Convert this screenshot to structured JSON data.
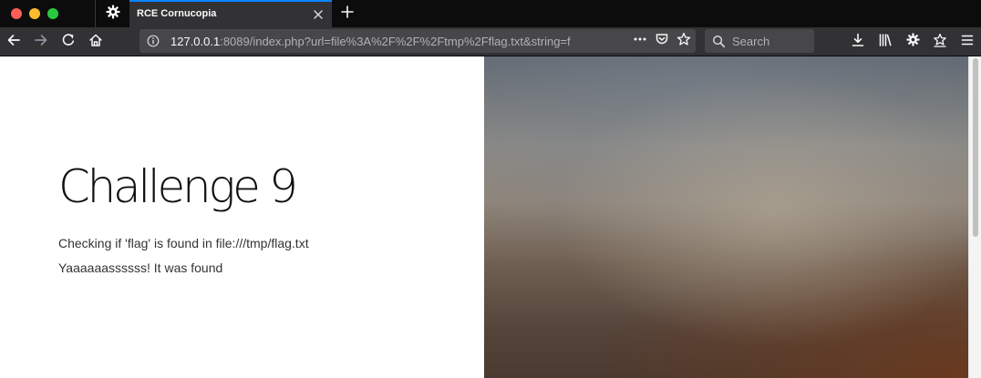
{
  "browser": {
    "tab": {
      "title": "RCE Cornucopia"
    },
    "url": {
      "host": "127.0.0.1",
      "rest": ":8089/index.php?url=file%3A%2F%2F%2Ftmp%2Fflag.txt&string=f"
    },
    "search": {
      "placeholder": "Search"
    }
  },
  "page": {
    "heading": "Challenge 9",
    "lines": [
      "Checking if 'flag' is found in file:///tmp/flag.txt",
      "Yaaaaaassssss! It was found"
    ]
  },
  "icons": {
    "tab_gear": "gear-icon",
    "tab_close": "close-icon",
    "new_tab": "plus-icon",
    "back": "arrow-left-icon",
    "forward": "arrow-right-icon",
    "reload": "reload-icon",
    "home": "home-icon",
    "info": "info-icon",
    "page_actions": "more-horizontal-icon",
    "pocket": "pocket-icon",
    "bookmark": "star-icon",
    "search": "search-icon",
    "downloads": "download-icon",
    "library": "library-icon",
    "settings": "gear-icon",
    "account": "star-account-icon",
    "menu": "hamburger-menu-icon"
  },
  "colors": {
    "tab_accent": "#0a84ff",
    "chrome_dark": "#0c0c0d",
    "toolbar": "#323234",
    "field": "#474749"
  }
}
